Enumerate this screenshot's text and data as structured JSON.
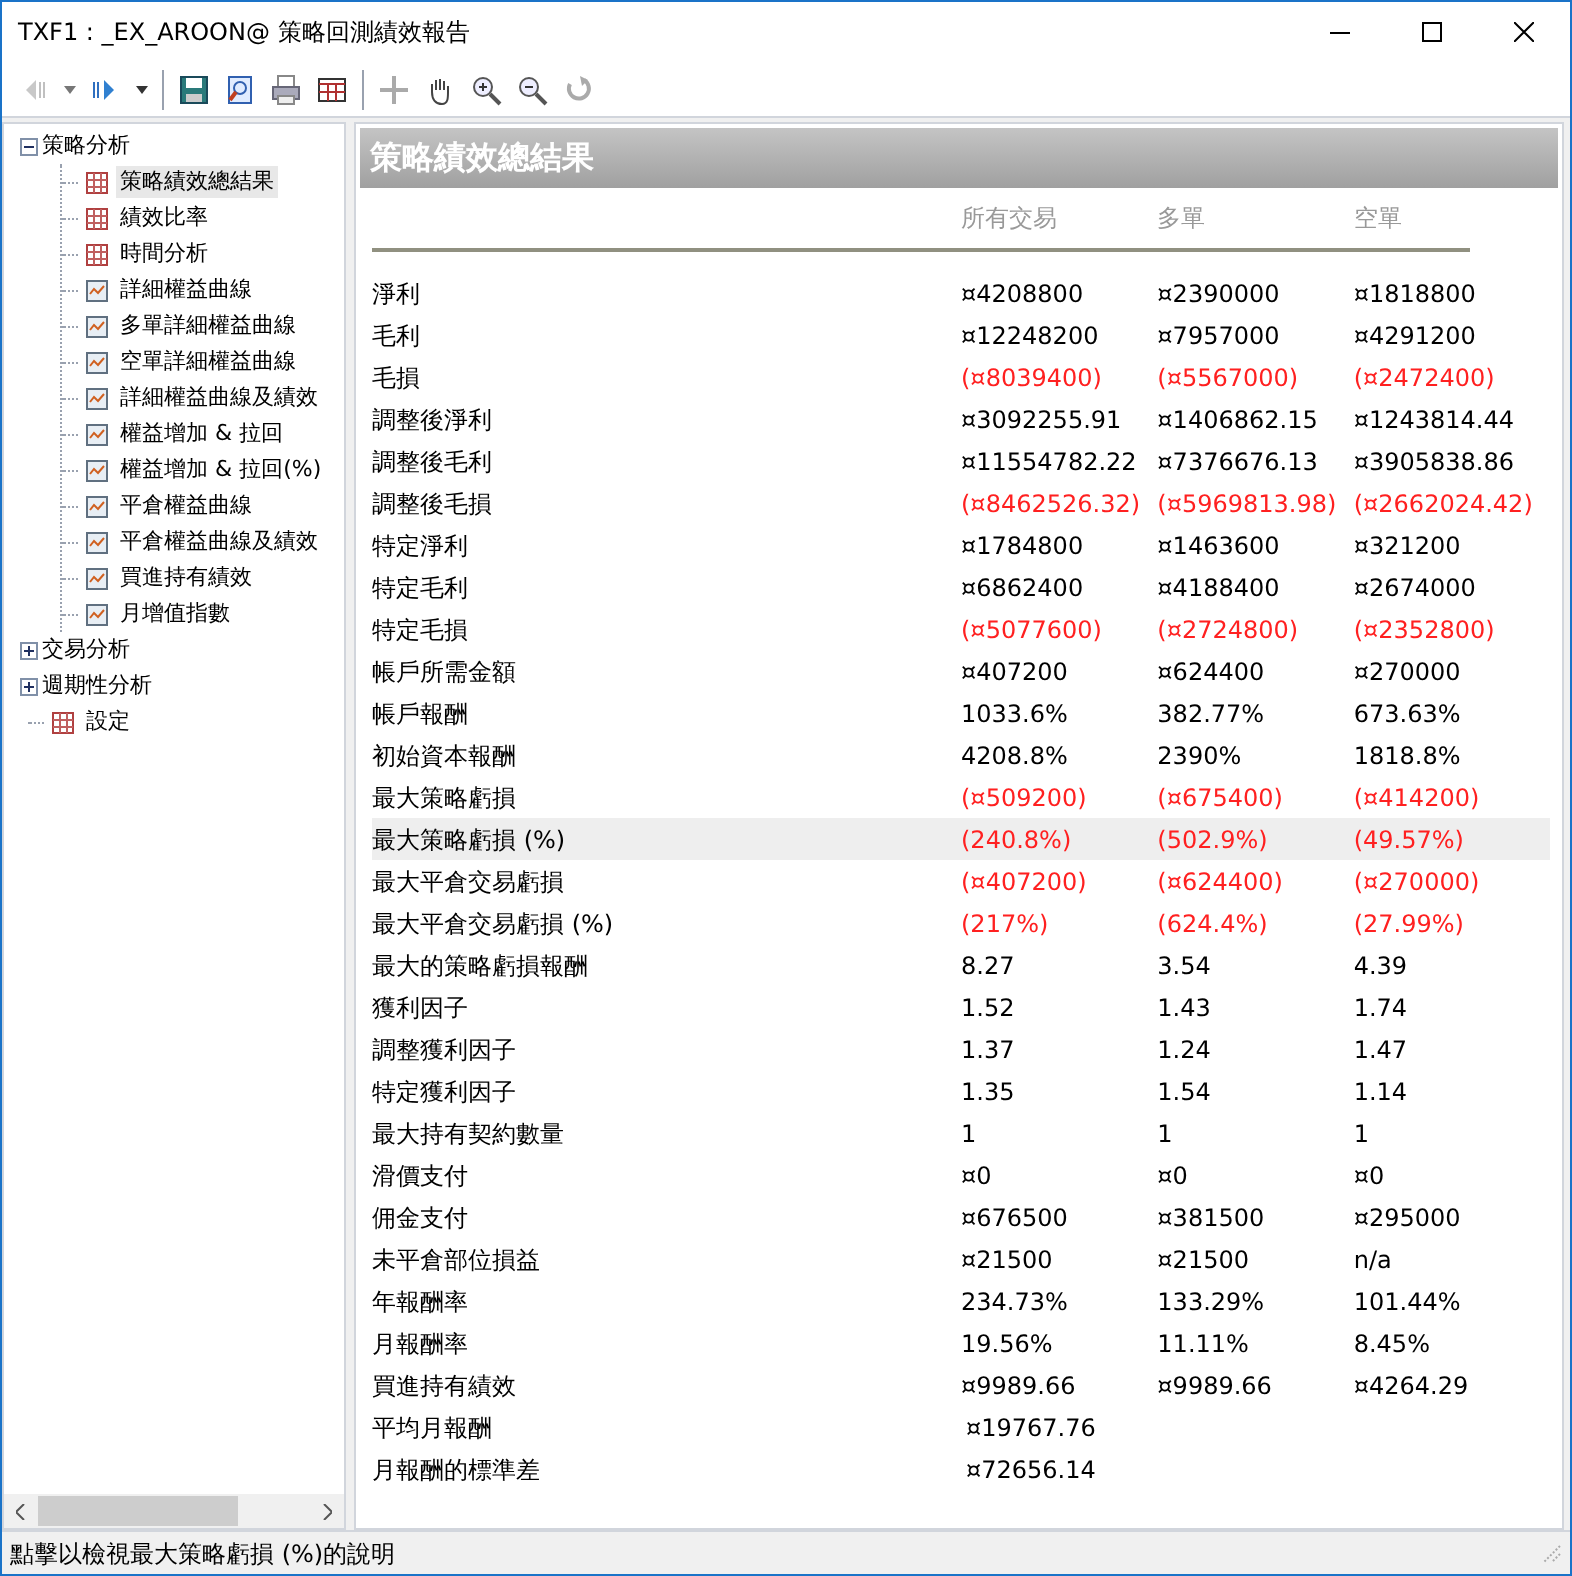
{
  "window": {
    "title": "TXF1 : _EX_AROON@ 策略回測績效報告"
  },
  "tree": [
    {
      "label": "策略分析",
      "expanded": true,
      "children": [
        {
          "label": "策略績效總結果",
          "kind": "table",
          "selected": true
        },
        {
          "label": "績效比率",
          "kind": "table",
          "selected": false
        },
        {
          "label": "時間分析",
          "kind": "table",
          "selected": false
        },
        {
          "label": "詳細權益曲線",
          "kind": "chart",
          "selected": false
        },
        {
          "label": "多單詳細權益曲線",
          "kind": "chart",
          "selected": false
        },
        {
          "label": "空單詳細權益曲線",
          "kind": "chart",
          "selected": false
        },
        {
          "label": "詳細權益曲線及績效",
          "kind": "chart",
          "selected": false
        },
        {
          "label": "權益增加 & 拉回",
          "kind": "chart",
          "selected": false
        },
        {
          "label": "權益增加 & 拉回(%)",
          "kind": "chart",
          "selected": false
        },
        {
          "label": "平倉權益曲線",
          "kind": "chart",
          "selected": false
        },
        {
          "label": "平倉權益曲線及績效",
          "kind": "chart",
          "selected": false
        },
        {
          "label": "買進持有績效",
          "kind": "chart",
          "selected": false
        },
        {
          "label": "月增值指數",
          "kind": "chart",
          "selected": false
        }
      ]
    },
    {
      "label": "交易分析",
      "expanded": false
    },
    {
      "label": "週期性分析",
      "expanded": false
    },
    {
      "label": "設定",
      "kind": "table",
      "selected": false
    }
  ],
  "report": {
    "title": "策略績效總結果",
    "columns": [
      "所有交易",
      "多單",
      "空單"
    ],
    "rows": [
      {
        "label": "淨利",
        "values": [
          "¤4208800",
          "¤2390000",
          "¤1818800"
        ],
        "negative": false,
        "selected": false
      },
      {
        "label": "毛利",
        "values": [
          "¤12248200",
          "¤7957000",
          "¤4291200"
        ],
        "negative": false,
        "selected": false
      },
      {
        "label": "毛損",
        "values": [
          "(¤8039400)",
          "(¤5567000)",
          "(¤2472400)"
        ],
        "negative": true,
        "selected": false
      },
      {
        "label": "調整後淨利",
        "values": [
          "¤3092255.91",
          "¤1406862.15",
          "¤1243814.44"
        ],
        "negative": false,
        "selected": false
      },
      {
        "label": "調整後毛利",
        "values": [
          "¤11554782.22",
          "¤7376676.13",
          "¤3905838.86"
        ],
        "negative": false,
        "selected": false
      },
      {
        "label": "調整後毛損",
        "values": [
          "(¤8462526.32)",
          "(¤5969813.98)",
          "(¤2662024.42)"
        ],
        "negative": true,
        "selected": false
      },
      {
        "label": "特定淨利",
        "values": [
          "¤1784800",
          "¤1463600",
          "¤321200"
        ],
        "negative": false,
        "selected": false
      },
      {
        "label": "特定毛利",
        "values": [
          "¤6862400",
          "¤4188400",
          "¤2674000"
        ],
        "negative": false,
        "selected": false
      },
      {
        "label": "特定毛損",
        "values": [
          "(¤5077600)",
          "(¤2724800)",
          "(¤2352800)"
        ],
        "negative": true,
        "selected": false
      },
      {
        "label": "帳戶所需金額",
        "values": [
          "¤407200",
          "¤624400",
          "¤270000"
        ],
        "negative": false,
        "selected": false
      },
      {
        "label": "帳戶報酬",
        "values": [
          "1033.6%",
          "382.77%",
          "673.63%"
        ],
        "negative": false,
        "selected": false
      },
      {
        "label": "初始資本報酬",
        "values": [
          "4208.8%",
          "2390%",
          "1818.8%"
        ],
        "negative": false,
        "selected": false
      },
      {
        "label": "最大策略虧損",
        "values": [
          "(¤509200)",
          "(¤675400)",
          "(¤414200)"
        ],
        "negative": true,
        "selected": false
      },
      {
        "label": "最大策略虧損 (%)",
        "values": [
          "(240.8%)",
          "(502.9%)",
          "(49.57%)"
        ],
        "negative": true,
        "selected": true
      },
      {
        "label": "最大平倉交易虧損",
        "values": [
          "(¤407200)",
          "(¤624400)",
          "(¤270000)"
        ],
        "negative": true,
        "selected": false
      },
      {
        "label": "最大平倉交易虧損 (%)",
        "values": [
          "(217%)",
          "(624.4%)",
          "(27.99%)"
        ],
        "negative": true,
        "selected": false
      },
      {
        "label": "最大的策略虧損報酬",
        "values": [
          "8.27",
          "3.54",
          "4.39"
        ],
        "negative": false,
        "selected": false
      },
      {
        "label": "獲利因子",
        "values": [
          "1.52",
          "1.43",
          "1.74"
        ],
        "negative": false,
        "selected": false
      },
      {
        "label": "調整獲利因子",
        "values": [
          "1.37",
          "1.24",
          "1.47"
        ],
        "negative": false,
        "selected": false
      },
      {
        "label": "特定獲利因子",
        "values": [
          "1.35",
          "1.54",
          "1.14"
        ],
        "negative": false,
        "selected": false
      },
      {
        "label": "最大持有契約數量",
        "values": [
          "1",
          "1",
          "1"
        ],
        "negative": false,
        "selected": false
      },
      {
        "label": "滑價支付",
        "values": [
          "¤0",
          "¤0",
          "¤0"
        ],
        "negative": false,
        "selected": false
      },
      {
        "label": "佣金支付",
        "values": [
          "¤676500",
          "¤381500",
          "¤295000"
        ],
        "negative": false,
        "selected": false
      },
      {
        "label": "未平倉部位損益",
        "values": [
          "¤21500",
          "¤21500",
          "n/a"
        ],
        "negative": false,
        "selected": false
      },
      {
        "label": "年報酬率",
        "values": [
          "234.73%",
          "133.29%",
          "101.44%"
        ],
        "negative": false,
        "selected": false
      },
      {
        "label": "月報酬率",
        "values": [
          "19.56%",
          "11.11%",
          "8.45%"
        ],
        "negative": false,
        "selected": false
      },
      {
        "label": "買進持有績效",
        "values": [
          "¤9989.66",
          "¤9989.66",
          "¤4264.29"
        ],
        "negative": false,
        "selected": false
      },
      {
        "label": "平均月報酬",
        "values": [
          "¤19767.76"
        ],
        "negative": false,
        "selected": false
      },
      {
        "label": "月報酬的標準差",
        "values": [
          "¤72656.14"
        ],
        "negative": false,
        "selected": false
      }
    ]
  },
  "status_bar": "點擊以檢視最大策略虧損 (%)的說明"
}
